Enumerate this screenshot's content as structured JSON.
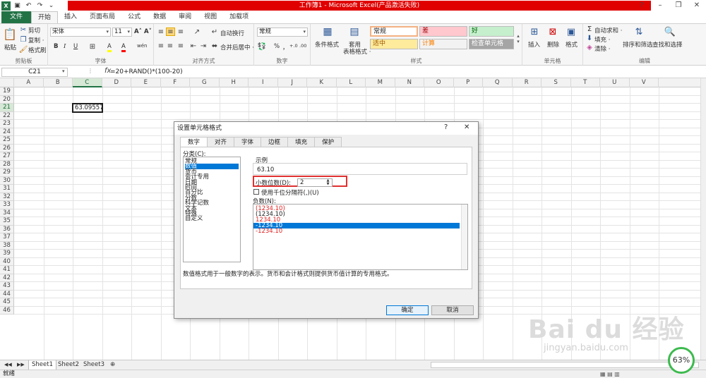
{
  "app": {
    "title": "工作簿1 - Microsoft Excel(产品激活失败)",
    "win_help": "?",
    "win_min": "–",
    "win_restore": "❐",
    "win_close": "✕"
  },
  "qat": {
    "undo_glyph": "↶",
    "redo_glyph": "↷",
    "more_glyph": "⌄"
  },
  "tabs": [
    {
      "label": "文件"
    },
    {
      "label": "开始"
    },
    {
      "label": "插入"
    },
    {
      "label": "页面布局"
    },
    {
      "label": "公式"
    },
    {
      "label": "数据"
    },
    {
      "label": "审阅"
    },
    {
      "label": "视图"
    },
    {
      "label": "加载项"
    }
  ],
  "ribbon": {
    "clipboard": {
      "paste": "粘贴",
      "cut": "剪切",
      "copy": "复制 ·",
      "format_painter": "格式刷",
      "label": "剪贴板"
    },
    "font": {
      "name": "宋体",
      "size": "11",
      "grow": "A˄",
      "shrink": "A˅",
      "bold": "B",
      "italic": "I",
      "underline": "U",
      "fill": "A",
      "color": "A",
      "phonetic": "wén",
      "label": "字体"
    },
    "alignment": {
      "wrap": "自动换行",
      "merge": "合并后居中 ·",
      "label": "对齐方式"
    },
    "number": {
      "format": "常规",
      "percent": "%",
      "comma": "，",
      "inc": "+.0",
      "dec": ".00",
      "label": "数字"
    },
    "styles": {
      "conditional": "条件格式",
      "table_format": "套用",
      "table_format2": "表格格式 ·",
      "cells": [
        {
          "text": "常规",
          "bg": "#ffffff",
          "color": "#222222"
        },
        {
          "text": "差",
          "bg": "#ffc7ce",
          "color": "#9c0006"
        },
        {
          "text": "好",
          "bg": "#c6efce",
          "color": "#006100"
        },
        {
          "text": "适中",
          "bg": "#ffeb9c",
          "color": "#9c5700"
        },
        {
          "text": "计算",
          "bg": "#f2f2f2",
          "color": "#fa7d00"
        },
        {
          "text": "检查单元格",
          "bg": "#a5a5a5",
          "color": "#ffffff"
        }
      ],
      "label": "样式"
    },
    "cells": {
      "insert": "插入",
      "delete": "删除",
      "format": "格式",
      "label": "单元格"
    },
    "editing": {
      "autosum": "自动求和 ·",
      "fill": "填充 ·",
      "clear": "清除 ·",
      "sort": "排序和筛选",
      "find": "查找和选择",
      "label": "编辑"
    }
  },
  "formula_bar": {
    "name_box": "C21",
    "fx": "fx",
    "formula": "=20+RAND()*(100-20)"
  },
  "grid": {
    "columns": [
      "A",
      "B",
      "C",
      "D",
      "E",
      "F",
      "G",
      "H",
      "I",
      "J",
      "K",
      "L",
      "M",
      "N",
      "O",
      "P",
      "Q",
      "R",
      "S",
      "T",
      "U",
      "V"
    ],
    "rows": [
      "19",
      "20",
      "21",
      "22",
      "23",
      "24",
      "25",
      "26",
      "27",
      "28",
      "29",
      "30",
      "31",
      "32",
      "33",
      "34",
      "35",
      "36",
      "37",
      "38",
      "39",
      "40",
      "41",
      "42",
      "43",
      "44",
      "45",
      "46"
    ],
    "active_value": "63.09557"
  },
  "sheets": [
    "Sheet1",
    "Sheet2",
    "Sheet3"
  ],
  "status": {
    "ready": "就绪"
  },
  "dialog": {
    "title": "设置单元格格式",
    "tabs": [
      "数字",
      "对齐",
      "字体",
      "边框",
      "填充",
      "保护"
    ],
    "category_label": "分类(C):",
    "categories": [
      "常规",
      "数值",
      "货币",
      "会计专用",
      "日期",
      "时间",
      "百分比",
      "分数",
      "科学记数",
      "文本",
      "特殊",
      "自定义"
    ],
    "selected_category": 1,
    "sample_label": "示例",
    "sample_value": "63.10",
    "decimal_label": "小数位数(D):",
    "decimal_value": "2",
    "thousands_label": "使用千位分隔符(,)(U)",
    "negative_label": "负数(N):",
    "negatives": [
      {
        "text": "(1234.10)",
        "red": true
      },
      {
        "text": "(1234.10)",
        "red": false
      },
      {
        "text": "1234.10",
        "red": true
      },
      {
        "text": "-1234.10",
        "red": false,
        "selected": true
      },
      {
        "text": "-1234.10",
        "red": true
      }
    ],
    "description": "数值格式用于一般数字的表示。货币和会计格式则提供货币值计算的专用格式。",
    "ok": "确定",
    "cancel": "取消"
  },
  "watermark": {
    "main": "Bai du 经验",
    "sub": "jingyan.baidu.com",
    "percent": "63%"
  }
}
